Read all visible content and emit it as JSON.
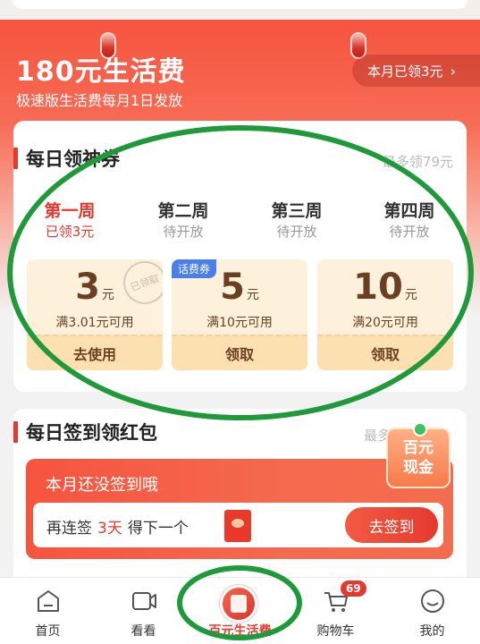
{
  "header": {
    "title": "180元生活费",
    "subtitle": "极速版生活费每月1日发放",
    "monthly_button": "本月已领3元",
    "chevron": "›"
  },
  "daily_coupons": {
    "title": "每日领神券",
    "right_text": "最多领79元",
    "weeks": [
      {
        "name": "第一周",
        "status": "已领3元",
        "active": true
      },
      {
        "name": "第二周",
        "status": "待开放"
      },
      {
        "name": "第三周",
        "status": "待开放"
      },
      {
        "name": "第四周",
        "status": "待开放"
      }
    ],
    "coupons": [
      {
        "amount": "3",
        "unit": "元",
        "condition": "满3.01元可用",
        "button": "去使用",
        "stamp": "已领取"
      },
      {
        "amount": "5",
        "unit": "元",
        "condition": "满10元可用",
        "button": "领取",
        "tag": "话费券"
      },
      {
        "amount": "10",
        "unit": "元",
        "condition": "满20元可用",
        "button": "领取"
      }
    ]
  },
  "daily_signin": {
    "title": "每日签到领红包",
    "right_text": "最多领",
    "banner_message": "本月还没签到哦",
    "row_prefix": "再连签",
    "row_days": "3天",
    "row_suffix": "得下一个",
    "button": "去签到",
    "badge_line1": "百元",
    "badge_line2": "现金"
  },
  "bottom_nav": {
    "items": [
      {
        "label": "首页",
        "icon": "home-icon"
      },
      {
        "label": "看看",
        "icon": "video-icon"
      },
      {
        "label": "百元生活费",
        "icon": "red-envelope-icon",
        "active": true
      },
      {
        "label": "购物车",
        "icon": "cart-icon",
        "badge": "69"
      },
      {
        "label": "我的",
        "icon": "smiley-icon"
      }
    ]
  },
  "colors": {
    "brand_red": "#e5392e",
    "annotation_green": "#1f9a3a",
    "coupon_bg": "#fef1dc",
    "tag_blue": "#4a7ee8"
  }
}
